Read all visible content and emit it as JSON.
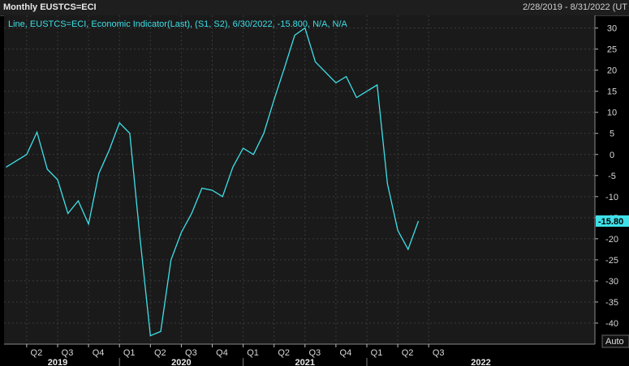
{
  "header": {
    "title": "Monthly EUSTCS=ECI",
    "date_range": "2/28/2019 - 8/31/2022 (UT"
  },
  "colors": {
    "line": "#3fe0e8",
    "plot_bg": "#1a1a1a",
    "grid": "#3a3a3a",
    "axis_bg": "#000000"
  },
  "chart_data": {
    "type": "line",
    "legend": "Line, EUSTCS=ECI, Economic Indicator(Last), (S1, S2), 6/30/2022, -15.800, N/A, N/A",
    "last_value_label": "-15.80",
    "auto_label": "Auto",
    "ylim": [
      -45,
      33
    ],
    "yticks": [
      30,
      25,
      20,
      15,
      10,
      5,
      0,
      -5,
      -10,
      -15,
      -20,
      -25,
      -30,
      -35,
      -40
    ],
    "ytick_labels": [
      "30",
      "25",
      "20",
      "15",
      "10",
      "5",
      "0",
      "-5",
      "-10",
      "-15",
      "-20",
      "-25",
      "-30",
      "-35",
      "-40"
    ],
    "x_start": "2019-02",
    "quarter_ticks": [
      {
        "label": "Q2",
        "m": "2019-04"
      },
      {
        "label": "Q3",
        "m": "2019-07"
      },
      {
        "label": "Q4",
        "m": "2019-10"
      },
      {
        "label": "Q1",
        "m": "2020-01"
      },
      {
        "label": "Q2",
        "m": "2020-04"
      },
      {
        "label": "Q3",
        "m": "2020-07"
      },
      {
        "label": "Q4",
        "m": "2020-10"
      },
      {
        "label": "Q1",
        "m": "2021-01"
      },
      {
        "label": "Q2",
        "m": "2021-04"
      },
      {
        "label": "Q3",
        "m": "2021-07"
      },
      {
        "label": "Q4",
        "m": "2021-10"
      },
      {
        "label": "Q1",
        "m": "2022-01"
      },
      {
        "label": "Q2",
        "m": "2022-04"
      },
      {
        "label": "Q3",
        "m": "2022-07"
      }
    ],
    "year_ticks": [
      {
        "label": "2019",
        "m": "2019-01"
      },
      {
        "label": "2020",
        "m": "2020-01"
      },
      {
        "label": "2021",
        "m": "2021-01"
      },
      {
        "label": "2022",
        "m": "2022-01"
      }
    ],
    "series": [
      {
        "x": [
          "2019-02",
          "2019-03",
          "2019-04",
          "2019-05",
          "2019-06",
          "2019-07",
          "2019-08",
          "2019-09",
          "2019-10",
          "2019-11",
          "2019-12",
          "2020-01",
          "2020-02",
          "2020-03",
          "2020-04",
          "2020-05",
          "2020-06",
          "2020-07",
          "2020-08",
          "2020-09",
          "2020-10",
          "2020-11",
          "2020-12",
          "2021-01",
          "2021-02",
          "2021-03",
          "2021-04",
          "2021-05",
          "2021-06",
          "2021-07",
          "2021-08",
          "2021-09",
          "2021-10",
          "2021-11",
          "2021-12",
          "2022-01",
          "2022-02",
          "2022-03",
          "2022-04",
          "2022-05",
          "2022-06"
        ],
        "values": [
          -3.0,
          -1.5,
          0.0,
          5.3,
          -3.5,
          -6.0,
          -14.0,
          -11.0,
          -16.5,
          -4.5,
          1.0,
          7.5,
          5.0,
          -20.0,
          -43.0,
          -42.0,
          -25.0,
          -18.5,
          -14.0,
          -8.0,
          -8.5,
          -10.0,
          -3.0,
          1.5,
          0.0,
          5.0,
          13.0,
          20.5,
          28.3,
          30.0,
          22.0,
          19.5,
          17.0,
          18.5,
          13.5,
          15.0,
          16.5,
          -7.0,
          -18.0,
          -22.5,
          -15.8
        ]
      }
    ]
  }
}
